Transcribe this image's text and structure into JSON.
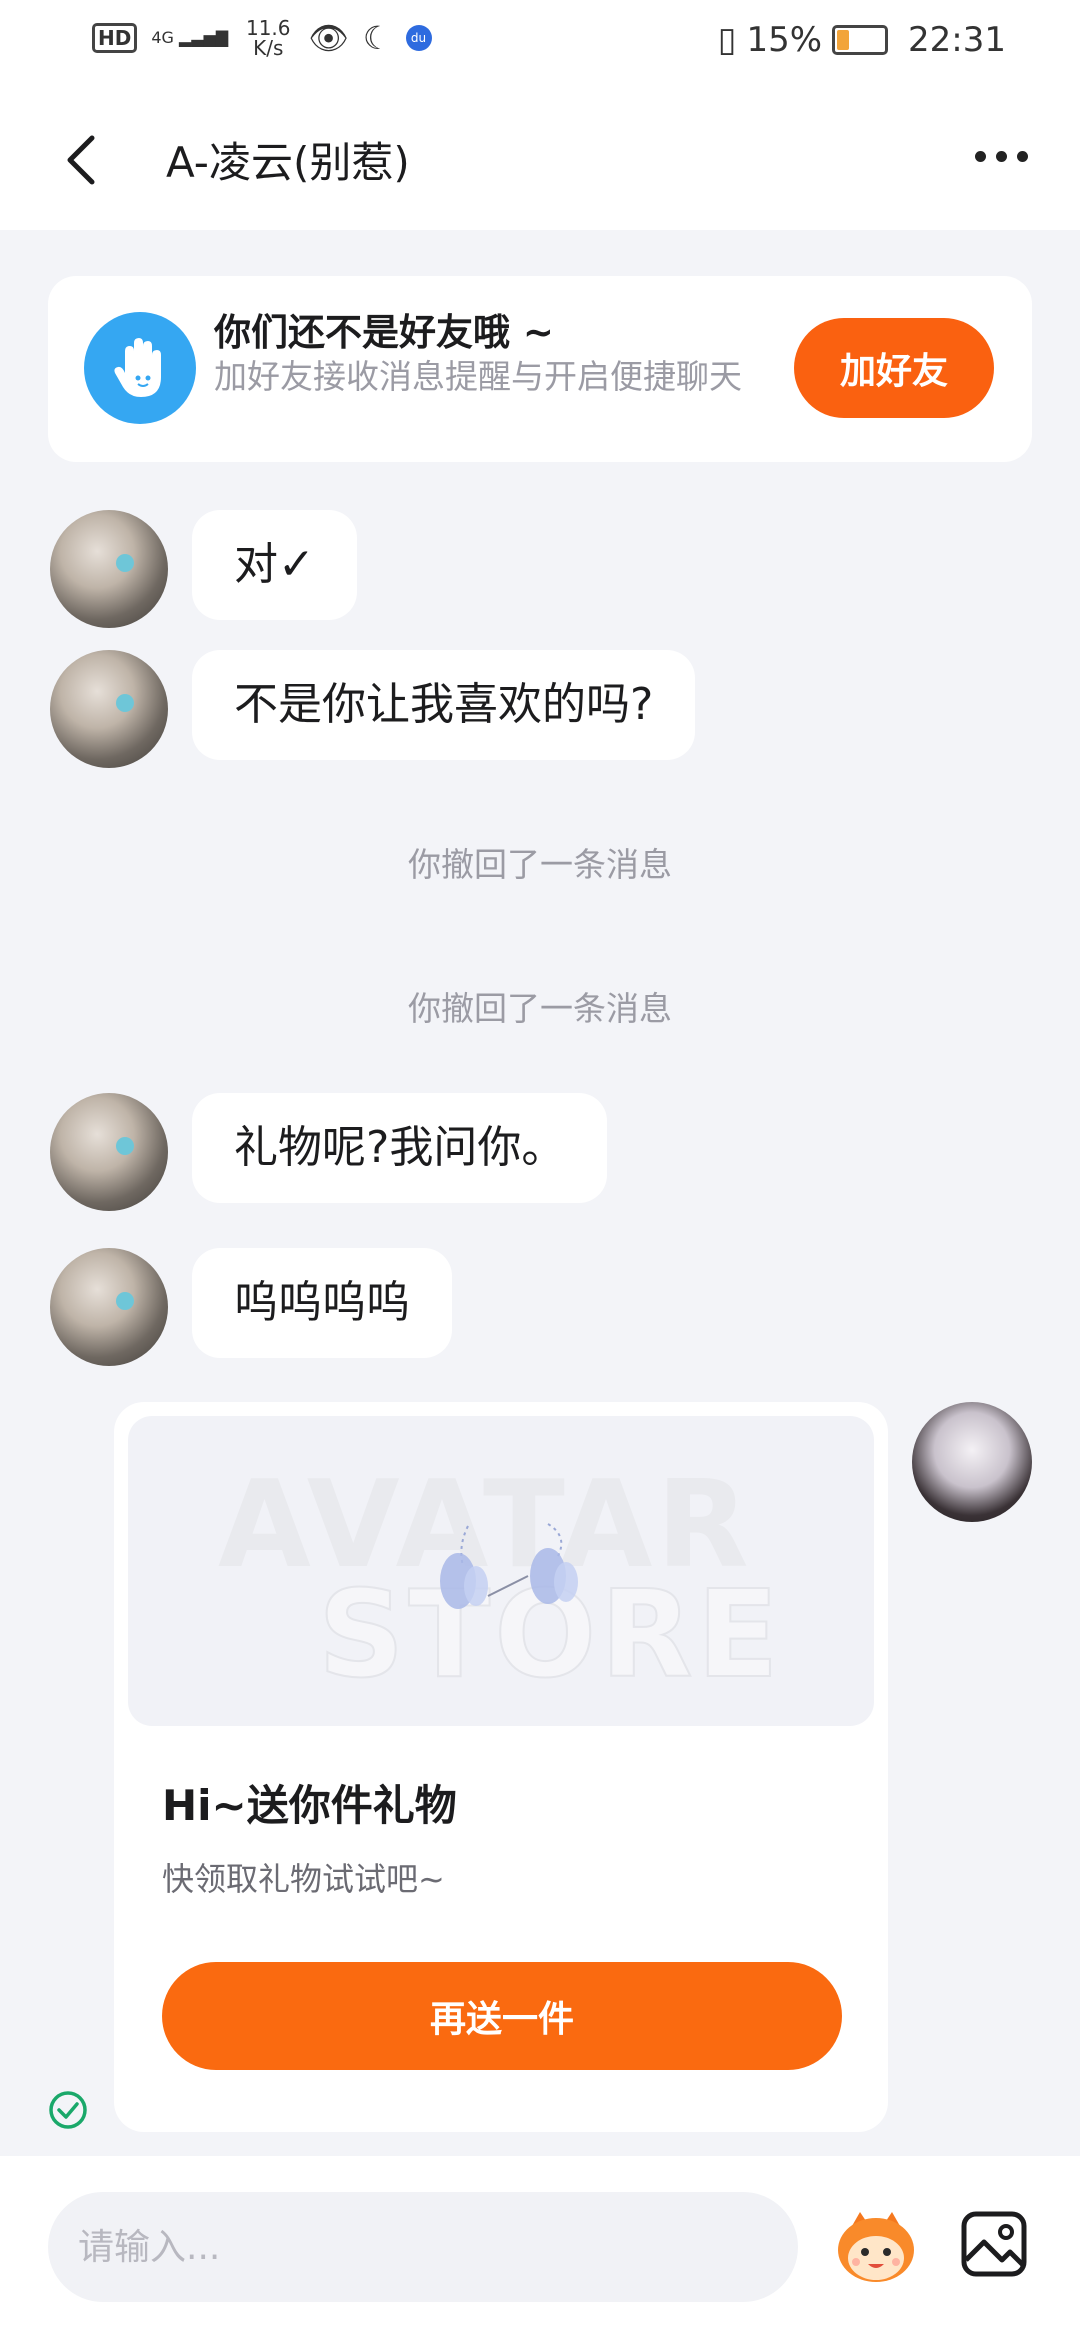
{
  "status_bar": {
    "hd": "HD",
    "network": "4G",
    "speed_value": "11.6",
    "speed_unit": "K/s",
    "battery": "15%",
    "time": "22:31"
  },
  "header": {
    "title": "A-凌云(别惹)"
  },
  "friend_banner": {
    "title": "你们还不是好友哦 ~",
    "description": "加好友接收消息提醒与开启便捷聊天",
    "button": "加好友"
  },
  "messages": [
    {
      "type": "received",
      "text": "对✓"
    },
    {
      "type": "received",
      "text": "不是你让我喜欢的吗?"
    },
    {
      "type": "system",
      "text": "你撤回了一条消息"
    },
    {
      "type": "system",
      "text": "你撤回了一条消息"
    },
    {
      "type": "received",
      "text": "礼物呢?我问你。"
    },
    {
      "type": "received",
      "text": "呜呜呜呜"
    }
  ],
  "gift_card": {
    "watermark_line1": "AVATAR",
    "watermark_line2": "STORE",
    "title": "Hi~送你件礼物",
    "subtitle": "快领取礼物试试吧~",
    "button": "再送一件"
  },
  "input_bar": {
    "placeholder": "请输入..."
  },
  "colors": {
    "accent": "#fa6110",
    "background": "#f3f4f8",
    "banner_icon": "#35a7f2",
    "read_check": "#1aa86a"
  }
}
